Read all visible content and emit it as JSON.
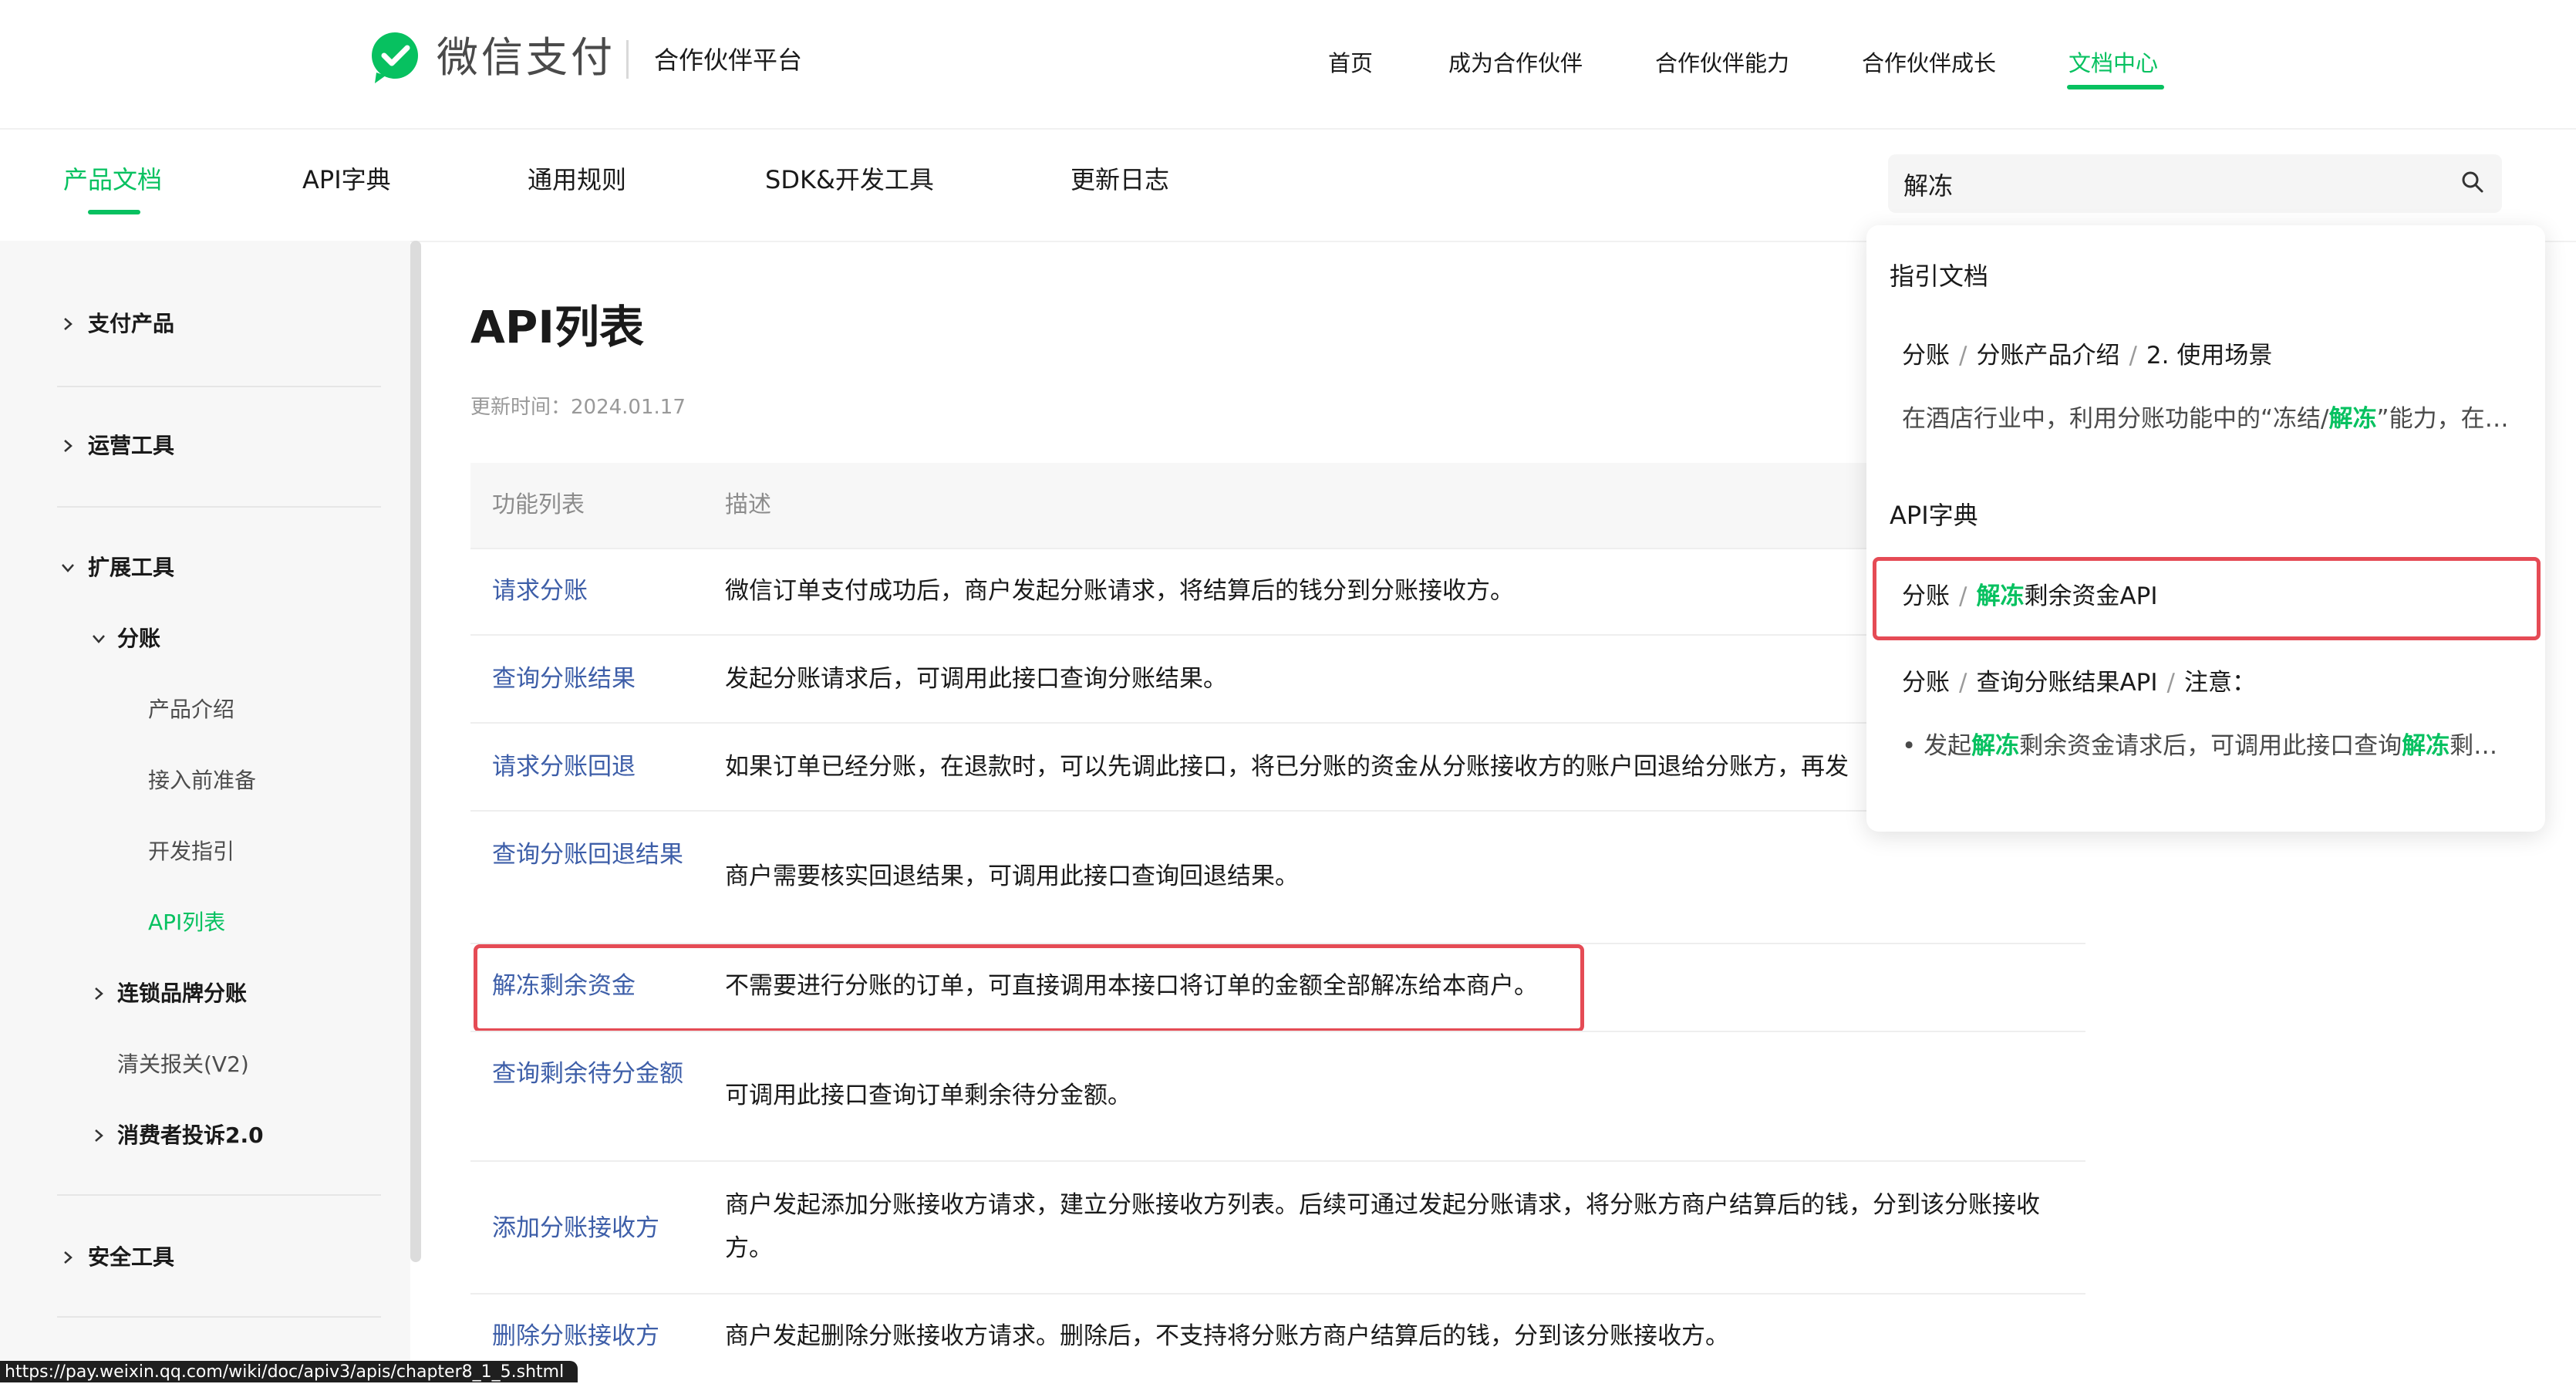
{
  "header": {
    "logo_text": "微信支付",
    "platform_title": "合作伙伴平台",
    "nav": [
      "首页",
      "成为合作伙伴",
      "合作伙伴能力",
      "合作伙伴成长",
      "文档中心"
    ],
    "active_nav": "文档中心",
    "accent_color": "#07c160"
  },
  "subnav": {
    "items": [
      "产品文档",
      "API字典",
      "通用规则",
      "SDK&开发工具",
      "更新日志"
    ],
    "active": "产品文档"
  },
  "search": {
    "value": "解冻",
    "icon": "search-icon"
  },
  "sidebar": {
    "pay_products": "支付产品",
    "ops_tools": "运营工具",
    "ext_tools": "扩展工具",
    "profit_sharing": "分账",
    "product_intro": "产品介绍",
    "prep": "接入前准备",
    "dev_guide": "开发指引",
    "api_list": "API列表",
    "chain_brand": "连锁品牌分账",
    "customs": "清关报关(V2)",
    "complaint": "消费者投诉2.0",
    "security_tools": "安全工具"
  },
  "main": {
    "title": "API列表",
    "update_time": "更新时间：2024.01.17",
    "columns": [
      "功能列表",
      "描述"
    ],
    "rows": [
      {
        "name": "请求分账",
        "desc": "微信订单支付成功后，商户发起分账请求，将结算后的钱分到分账接收方。"
      },
      {
        "name": "查询分账结果",
        "desc": "发起分账请求后，可调用此接口查询分账结果。"
      },
      {
        "name": "请求分账回退",
        "desc": "如果订单已经分账，在退款时，可以先调此接口，将已分账的资金从分账接收方的账户回退给分账方，再发"
      },
      {
        "name": "查询分账回退结果",
        "desc": "商户需要核实回退结果，可调用此接口查询回退结果。"
      },
      {
        "name": "解冻剩余资金",
        "desc": "不需要进行分账的订单，可直接调用本接口将订单的金额全部解冻给本商户。"
      },
      {
        "name": "查询剩余待分金额",
        "desc": "可调用此接口查询订单剩余待分金额。"
      },
      {
        "name": "添加分账接收方",
        "desc": "商户发起添加分账接收方请求，建立分账接收方列表。后续可通过发起分账请求，将分账方商户结算后的钱，分到该分账接收方。"
      },
      {
        "name": "删除分账接收方",
        "desc": "商户发起删除分账接收方请求。删除后，不支持将分账方商户结算后的钱，分到该分账接收方。"
      }
    ]
  },
  "dropdown": {
    "group1": "指引文档",
    "g1_path": [
      "分账",
      "分账产品介绍",
      "2. 使用场景"
    ],
    "g1_snippet_pre": "在酒店行业中，利用分账功能中的“冻结/",
    "g1_snippet_hl": "解冻",
    "g1_snippet_post": "”能力，在客户离店前有",
    "group2": "API字典",
    "g2_item1_parent": "分账",
    "g2_item1_hl": "解冻",
    "g2_item1_rest": "剩余资金API",
    "g2_item2_path": [
      "分账",
      "查询分账结果API",
      "注意："
    ],
    "g2_snippet_bullet": "•",
    "g2_snippet_a": "发起",
    "g2_snippet_hl1": "解冻",
    "g2_snippet_b": "剩余资金请求后，可调用此接口查询",
    "g2_snippet_hl2": "解冻",
    "g2_snippet_c": "剩余资金结果"
  },
  "status_url": "https://pay.weixin.qq.com/wiki/doc/apiv3/apis/chapter8_1_5.shtml"
}
